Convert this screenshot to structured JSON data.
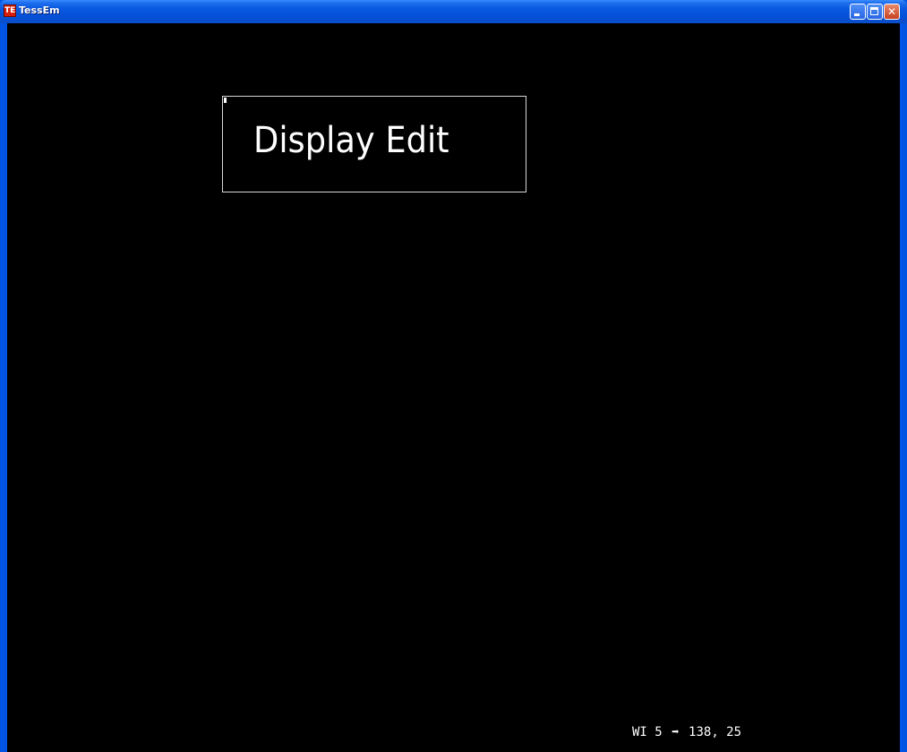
{
  "window": {
    "title": "TessEm",
    "app_icon": "tessem-app-icon",
    "controls": {
      "minimize_icon": "minimize-icon",
      "maximize_icon": "maximize-icon",
      "close_icon": "close-icon"
    }
  },
  "screen": {
    "display_title": "Display Edit",
    "status": {
      "prefix": "WI 5",
      "arrow_icon": "right-arrow-icon",
      "coords": "138, 25"
    }
  }
}
